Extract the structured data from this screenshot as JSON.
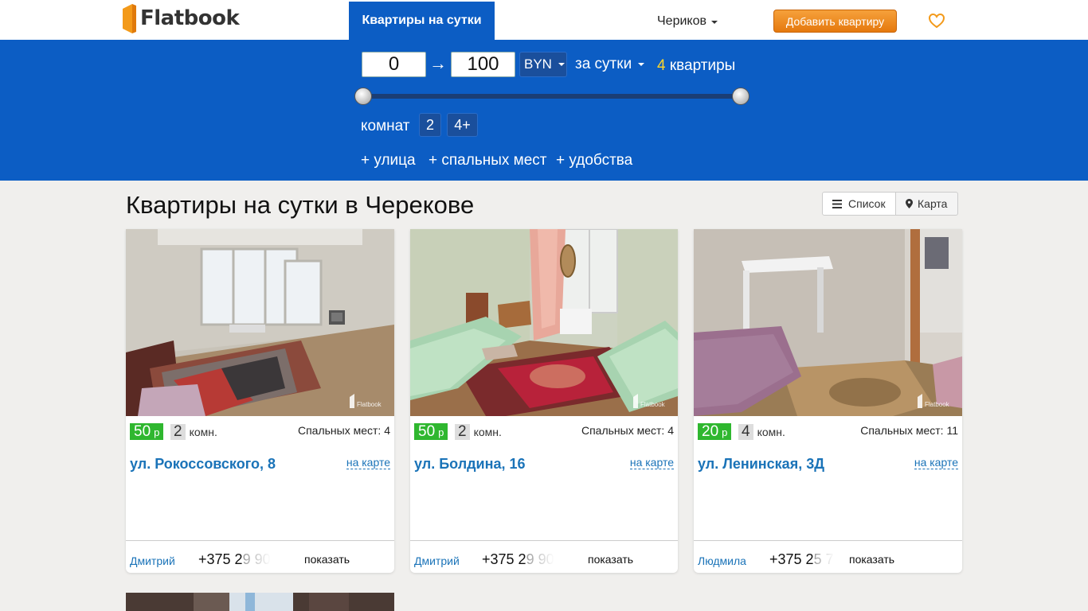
{
  "header": {
    "logo_text": "Flatbook",
    "nav_tab": "Квартиры на сутки",
    "city": "Чериков",
    "add_button": "Добавить квартиру"
  },
  "filter": {
    "min_price": "0",
    "arrow": "→",
    "max_price": "100",
    "currency": "BYN",
    "period": "за сутки",
    "count_number": "4",
    "count_label": "квартиры",
    "slider": {
      "min": 0,
      "max": 100,
      "low": 0,
      "high": 100
    },
    "rooms_label": "комнат",
    "room_options": [
      "2",
      "4+"
    ],
    "extras": [
      "+ улица",
      "+ спальных мест",
      "+ удобства"
    ]
  },
  "main": {
    "title": "Квартиры на сутки в Черекове",
    "view_list": "Список",
    "view_map": "Карта"
  },
  "listings": [
    {
      "price": "50",
      "currency_short": "р",
      "rooms": "2",
      "rooms_unit": "комн.",
      "beds": "Спальных мест: 4",
      "address": "ул. Рокоссовского, 8",
      "map_link": "на карте",
      "owner": "Дмитрий",
      "phone_visible": "+375 2",
      "phone_faded": "9 90",
      "show_label": "показать",
      "watermark": "Flatbook"
    },
    {
      "price": "50",
      "currency_short": "р",
      "rooms": "2",
      "rooms_unit": "комн.",
      "beds": "Спальных мест: 4",
      "address": "ул. Болдина, 16",
      "map_link": "на карте",
      "owner": "Дмитрий",
      "phone_visible": "+375 2",
      "phone_faded": "9 90",
      "show_label": "показать",
      "watermark": "Flatbook"
    },
    {
      "price": "20",
      "currency_short": "р",
      "rooms": "4",
      "rooms_unit": "комн.",
      "beds": "Спальных мест: 11",
      "address": "ул. Ленинская, 3Д",
      "map_link": "на карте",
      "owner": "Людмила",
      "phone_visible": "+375 2",
      "phone_faded": "5 7",
      "show_label": "показать",
      "watermark": "Flatbook"
    }
  ],
  "colors": {
    "brand_blue": "#0c5dc4",
    "accent_orange": "#e5790e",
    "price_green": "#2fb72f",
    "link_blue": "#1a73b8",
    "count_yellow": "#ffd629"
  },
  "icons": [
    "door-logo-icon",
    "heart-icon",
    "menu-icon",
    "map-pin-icon"
  ]
}
